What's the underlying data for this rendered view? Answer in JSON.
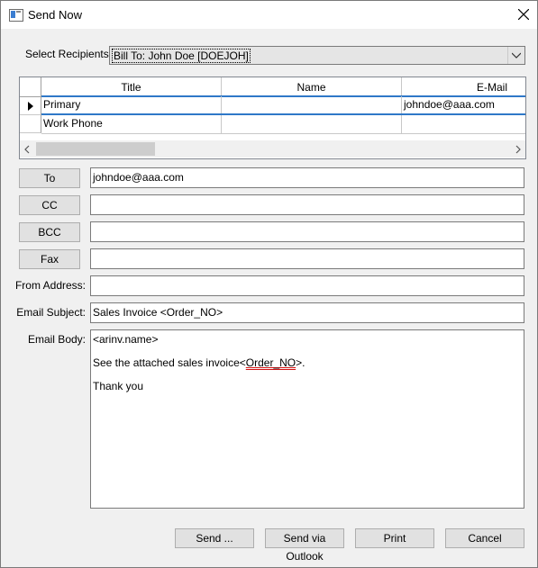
{
  "window": {
    "title": "Send Now"
  },
  "recipients": {
    "label": "Select Recipients:",
    "selected": "Bill To: John Doe [DOEJOH]"
  },
  "grid": {
    "columns": [
      "Title",
      "Name",
      "E-Mail"
    ],
    "rows": [
      {
        "title": "Primary",
        "name": "",
        "email": "johndoe@aaa.com"
      },
      {
        "title": "Work Phone",
        "name": "",
        "email": ""
      }
    ]
  },
  "buttons": {
    "to": "To",
    "cc": "CC",
    "bcc": "BCC",
    "fax": "Fax"
  },
  "fields": {
    "to": "johndoe@aaa.com",
    "cc": "",
    "bcc": "",
    "fax": "",
    "from_label": "From Address:",
    "from": "",
    "subject_label": "Email Subject:",
    "subject": "Sales Invoice <Order_NO>",
    "body_label": "Email Body:"
  },
  "body": {
    "line1": "<arinv.name>",
    "line2_prefix": "See the attached sales invoice<",
    "line2_misspelled": "Order_NO",
    "line2_suffix": ">.",
    "line3": "Thank you"
  },
  "actions": {
    "send": "Send ...",
    "outlook": "Send via Outlook",
    "print": "Print",
    "cancel": "Cancel"
  }
}
